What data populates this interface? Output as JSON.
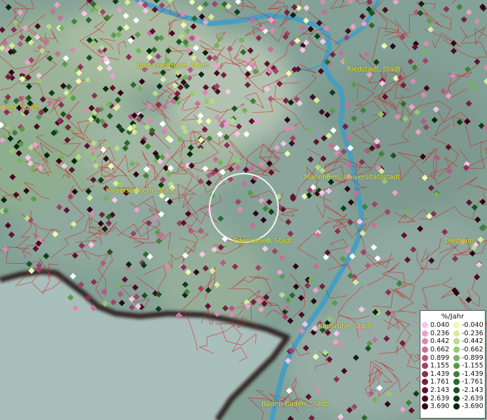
{
  "cities": [
    {
      "name": "Bad Kreuznach, Stadt"
    },
    {
      "name": "Riedstadt, Stadt"
    },
    {
      "name": "rtem, Stadt"
    },
    {
      "name": "Kaiserslautern, Stadt"
    },
    {
      "name": "Mannheim, Universitätsstadt"
    },
    {
      "name": "Edenkoben, Stadt"
    },
    {
      "name": "Dielheim"
    },
    {
      "name": "Karlsruhe, Stadt"
    },
    {
      "name": "Baden-Baden, Stadt"
    }
  ],
  "legend": {
    "title": "%/Jahr",
    "positive": [
      {
        "label": "0.040",
        "color": "#f6c6e6"
      },
      {
        "label": "0.236",
        "color": "#eaa2cc"
      },
      {
        "label": "0.442",
        "color": "#d98bb2"
      },
      {
        "label": "0.662",
        "color": "#c66f99"
      },
      {
        "label": "0.899",
        "color": "#b45a82"
      },
      {
        "label": "1.155",
        "color": "#9f4468"
      },
      {
        "label": "1.439",
        "color": "#8a3052"
      },
      {
        "label": "1.761",
        "color": "#742040"
      },
      {
        "label": "2.143",
        "color": "#5e1230"
      },
      {
        "label": "2.639",
        "color": "#470a22"
      },
      {
        "label": "3.690",
        "color": "#300414"
      }
    ],
    "negative": [
      {
        "label": "-0.040",
        "color": "#f3f7b0"
      },
      {
        "label": "-0.236",
        "color": "#d7ec9a"
      },
      {
        "label": "-0.442",
        "color": "#b6dc86"
      },
      {
        "label": "-0.662",
        "color": "#95c872"
      },
      {
        "label": "-0.899",
        "color": "#76b25e"
      },
      {
        "label": "-1.155",
        "color": "#5a9a4c"
      },
      {
        "label": "-1.439",
        "color": "#3f823a"
      },
      {
        "label": "-1.761",
        "color": "#2a6a2c"
      },
      {
        "label": "-2.143",
        "color": "#1a5420"
      },
      {
        "label": "-2.639",
        "color": "#0e3e15"
      },
      {
        "label": "-3.690",
        "color": "#05270b"
      }
    ]
  },
  "colors": {
    "river": "#3f9ec6",
    "boundary": "#d02020",
    "state_border": "#2a1c1a",
    "label": "#e6e23a"
  }
}
